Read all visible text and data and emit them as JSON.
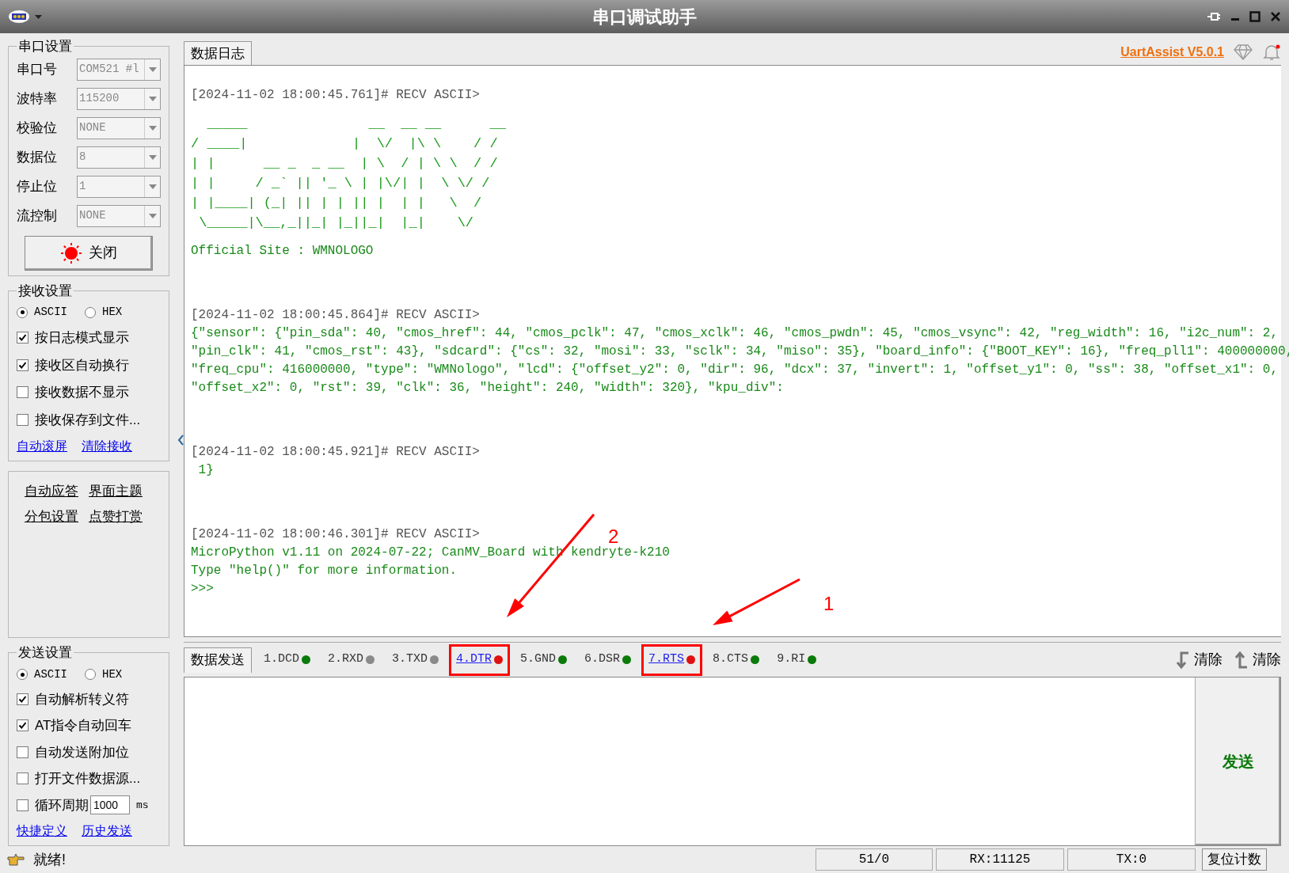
{
  "window": {
    "title": "串口调试助手"
  },
  "port_settings": {
    "title": "串口设置",
    "fields": [
      {
        "label": "串口号",
        "value": "COM521 #l"
      },
      {
        "label": "波特率",
        "value": "115200"
      },
      {
        "label": "校验位",
        "value": "NONE"
      },
      {
        "label": "数据位",
        "value": "8"
      },
      {
        "label": "停止位",
        "value": "1"
      },
      {
        "label": "流控制",
        "value": "NONE"
      }
    ],
    "open_button": {
      "label": "关闭",
      "on": true
    }
  },
  "receive_settings": {
    "title": "接收设置",
    "modes": [
      {
        "label": "ASCII",
        "selected": true
      },
      {
        "label": "HEX",
        "selected": false
      }
    ],
    "options": [
      {
        "label": "按日志模式显示",
        "checked": true
      },
      {
        "label": "接收区自动换行",
        "checked": true
      },
      {
        "label": "接收数据不显示",
        "checked": false
      },
      {
        "label": "接收保存到文件...",
        "checked": false
      }
    ],
    "links": [
      "自动滚屏",
      "清除接收"
    ]
  },
  "extra_links": [
    "自动应答",
    "界面主题",
    "分包设置",
    "点赞打赏"
  ],
  "send_settings": {
    "title": "发送设置",
    "modes": [
      {
        "label": "ASCII",
        "selected": true
      },
      {
        "label": "HEX",
        "selected": false
      }
    ],
    "options": [
      {
        "label": "自动解析转义符",
        "checked": true
      },
      {
        "label": "AT指令自动回车",
        "checked": true
      },
      {
        "label": "自动发送附加位",
        "checked": false
      },
      {
        "label": "打开文件数据源...",
        "checked": false
      },
      {
        "label": "循环周期",
        "checked": false
      }
    ],
    "period": {
      "value": "1000",
      "unit": "ms"
    },
    "links": [
      "快捷定义",
      "历史发送"
    ]
  },
  "log_tab": {
    "label": "数据日志"
  },
  "version_link": "UartAssist V5.0.1",
  "log": [
    {
      "header": "[2024-11-02 18:00:45.761]# RECV ASCII>",
      "blocks": [
        {
          "kind": "art",
          "lines": [
            "  _____               __  __ __      __",
            "/ ____|             |  \\/  |\\ \\    / /",
            "| |      __ _  _ __  | \\  / | \\ \\  / /",
            "| |     / _` || '_ \\ | |\\/| |  \\ \\/ /",
            "| |____| (_| || | | || |  | |   \\  /",
            " \\_____|\\__,_||_| |_||_|  |_|    \\/"
          ]
        },
        {
          "kind": "text",
          "lines": [
            "Official Site : WMNOLOGO"
          ]
        }
      ]
    },
    {
      "header": "[2024-11-02 18:00:45.864]# RECV ASCII>",
      "blocks": [
        {
          "kind": "text",
          "lines": [
            "{\"sensor\": {\"pin_sda\": 40, \"cmos_href\": 44, \"cmos_pclk\": 47, \"cmos_xclk\": 46, \"cmos_pwdn\": 45, \"cmos_vsync\": 42, \"reg_width\": 16, \"i2c_num\": 2,",
            "\"pin_clk\": 41, \"cmos_rst\": 43}, \"sdcard\": {\"cs\": 32, \"mosi\": 33, \"sclk\": 34, \"miso\": 35}, \"board_info\": {\"BOOT_KEY\": 16}, \"freq_pll1\": 400000000,",
            "\"freq_cpu\": 416000000, \"type\": \"WMNologo\", \"lcd\": {\"offset_y2\": 0, \"dir\": 96, \"dcx\": 37, \"invert\": 1, \"offset_y1\": 0, \"ss\": 38, \"offset_x1\": 0,",
            "\"offset_x2\": 0, \"rst\": 39, \"clk\": 36, \"height\": 240, \"width\": 320}, \"kpu_div\":"
          ]
        }
      ]
    },
    {
      "header": "[2024-11-02 18:00:45.921]# RECV ASCII>",
      "blocks": [
        {
          "kind": "text",
          "lines": [
            " 1}"
          ]
        }
      ]
    },
    {
      "header": "[2024-11-02 18:00:46.301]# RECV ASCII>",
      "blocks": [
        {
          "kind": "text",
          "lines": [
            "MicroPython v1.11 on 2024-07-22; CanMV_Board with kendryte-k210",
            "Type \"help()\" for more information.",
            ">>>"
          ]
        }
      ]
    }
  ],
  "send_tab": {
    "label": "数据发送"
  },
  "pins": [
    {
      "label": "1.DCD",
      "kind": "label",
      "color": "#0a7a0a",
      "highlighted": false
    },
    {
      "label": "2.RXD",
      "kind": "label",
      "color": "#8a8a8a",
      "highlighted": false
    },
    {
      "label": "3.TXD",
      "kind": "label",
      "color": "#8a8a8a",
      "highlighted": false
    },
    {
      "label": "4.DTR",
      "kind": "link",
      "color": "#e01010",
      "highlighted": true
    },
    {
      "label": "5.GND",
      "kind": "label",
      "color": "#0a7a0a",
      "highlighted": false
    },
    {
      "label": "6.DSR",
      "kind": "label",
      "color": "#0a7a0a",
      "highlighted": false
    },
    {
      "label": "7.RTS",
      "kind": "link",
      "color": "#e01010",
      "highlighted": true
    },
    {
      "label": "8.CTS",
      "kind": "label",
      "color": "#0a7a0a",
      "highlighted": false
    },
    {
      "label": "9.RI",
      "kind": "label",
      "color": "#0a7a0a",
      "highlighted": false
    }
  ],
  "clear_buttons": [
    {
      "label": "清除",
      "kind": "down"
    },
    {
      "label": "清除",
      "kind": "up"
    }
  ],
  "send_button": "发送",
  "annotations": [
    "2",
    "1"
  ],
  "status_bar": {
    "message": "就绪!",
    "counters": [
      "51/0",
      "RX:11125",
      "TX:0"
    ],
    "reset_button": "复位计数"
  }
}
